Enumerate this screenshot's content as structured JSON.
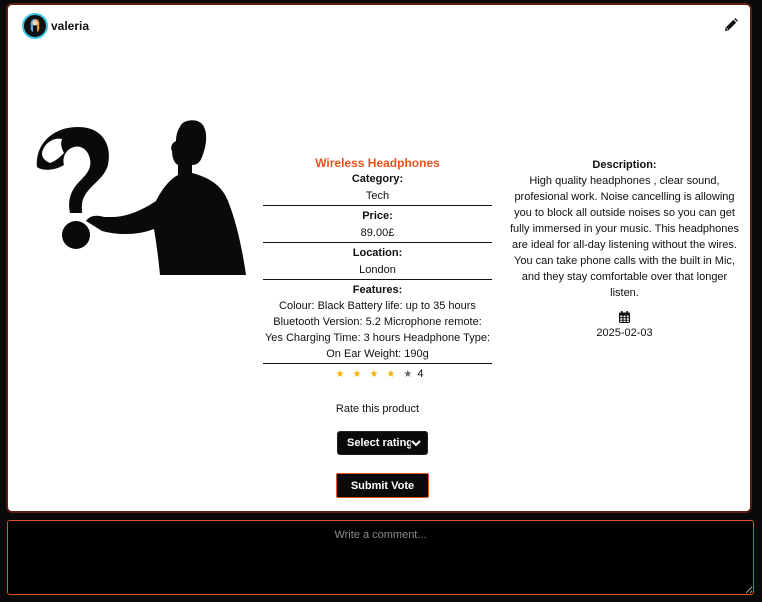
{
  "author": {
    "name": "valeria"
  },
  "icons": {
    "edit": "pencil-icon",
    "date": "calendar-icon",
    "avatar": "user-avatar"
  },
  "product": {
    "title": "Wireless Headphones",
    "category_label": "Category:",
    "category": "Tech",
    "price_label": "Price:",
    "price": "89.00£",
    "location_label": "Location:",
    "location": "London",
    "features_label": "Features:",
    "features": "Colour: Black Battery life: up to 35 hours Bluetooth Version: 5.2 Microphone remote: Yes Charging Time: 3 hours Headphone Type: On Ear Weight: 190g",
    "rating": 4,
    "rating_max": 5,
    "rating_text": "4"
  },
  "description": {
    "label": "Description:",
    "text": "High quality headphones , clear sound, profesional work. Noise cancelling is allowing you to block all outside noises so you can get fully immersed in your music. This headphones are ideal for all-day listening without the wires. You can take phone calls with the built in Mic, and they stay comfortable over that longer listen.",
    "date": "2025-02-03"
  },
  "rate": {
    "label": "Rate this product",
    "select_value": "Select rating",
    "submit_label": "Submit Vote"
  },
  "comment": {
    "placeholder": "Write a comment..."
  },
  "colors": {
    "accent": "#e8531d",
    "star": "#f5b301",
    "avatar_ring": "#3fc6e8"
  }
}
